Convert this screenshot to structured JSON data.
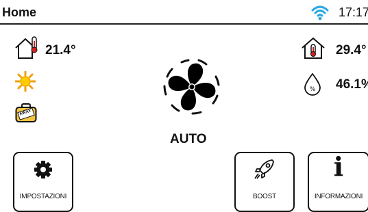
{
  "status": {
    "title": "Home",
    "time": "17:17",
    "wifi_color": "#2aa7e0"
  },
  "readings": {
    "indoor_temp": "21.4°",
    "outdoor_temp": "29.4°",
    "humidity": "46.1%"
  },
  "fan": {
    "mode": "AUTO"
  },
  "badges": {
    "away_text": "AWAY"
  },
  "icons": {
    "indoor": "house-thermometer-icon",
    "outdoor": "house-thermometer-icon",
    "humidity": "water-drop-percent-icon",
    "weather": "sun-icon",
    "away": "suitcase-away-icon",
    "fan": "fan-icon",
    "settings": "gear-icon",
    "boost": "rocket-icon",
    "info": "info-icon",
    "wifi": "wifi-icon"
  },
  "buttons": {
    "settings_label": "IMPOSTAZIONI",
    "boost_label": "BOOST",
    "info_label": "INFORMAZIONI",
    "info_glyph": "i"
  }
}
